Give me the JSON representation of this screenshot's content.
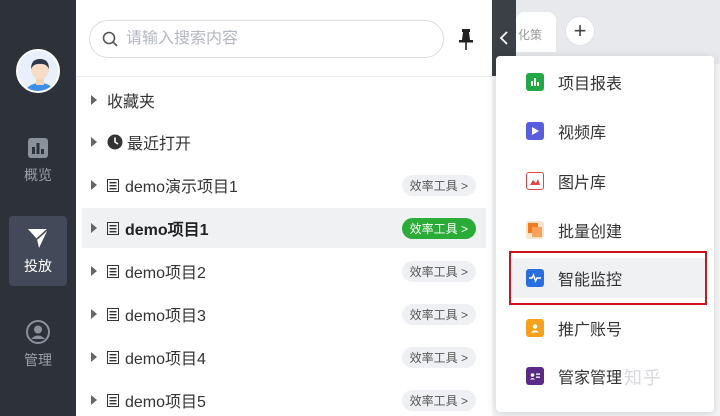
{
  "sidebar": {
    "items": [
      {
        "label": "概览",
        "icon": "bar-chart-icon"
      },
      {
        "label": "投放",
        "icon": "send-icon",
        "active": true
      },
      {
        "label": "管理",
        "icon": "user-icon"
      }
    ]
  },
  "panel": {
    "search_placeholder": "请输入搜索内容",
    "rows": [
      {
        "label": "收藏夹",
        "icon": "none"
      },
      {
        "label": "最近打开",
        "icon": "clock-icon"
      },
      {
        "label": "demo演示项目1",
        "icon": "document-icon",
        "tag": "效率工具 >"
      },
      {
        "label": "demo项目1",
        "icon": "document-icon",
        "tag": "效率工具 >",
        "selected": true
      },
      {
        "label": "demo项目2",
        "icon": "document-icon",
        "tag": "效率工具 >"
      },
      {
        "label": "demo项目3",
        "icon": "document-icon",
        "tag": "效率工具 >"
      },
      {
        "label": "demo项目4",
        "icon": "document-icon",
        "tag": "效率工具 >"
      },
      {
        "label": "demo项目5",
        "icon": "document-icon",
        "tag": "效率工具 >"
      }
    ]
  },
  "tabs": {
    "partial_tab": "化策",
    "add": "+"
  },
  "menu": {
    "items": [
      {
        "label": "项目报表",
        "color": "#22a845"
      },
      {
        "label": "视频库",
        "color": "#5b5de0"
      },
      {
        "label": "图片库",
        "color": "#e04848"
      },
      {
        "label": "批量创建",
        "color": "#f07a1d"
      },
      {
        "label": "智能监控",
        "color": "#2a6fe0",
        "highlighted": true
      },
      {
        "label": "推广账号",
        "color": "#f5a11c"
      },
      {
        "label": "管家管理",
        "color": "#5a2a86"
      }
    ]
  },
  "watermark": "知乎",
  "colors": {
    "sidebar_bg": "#2d3139",
    "tag_active": "#2bab37",
    "highlight_border": "#d0131b"
  }
}
